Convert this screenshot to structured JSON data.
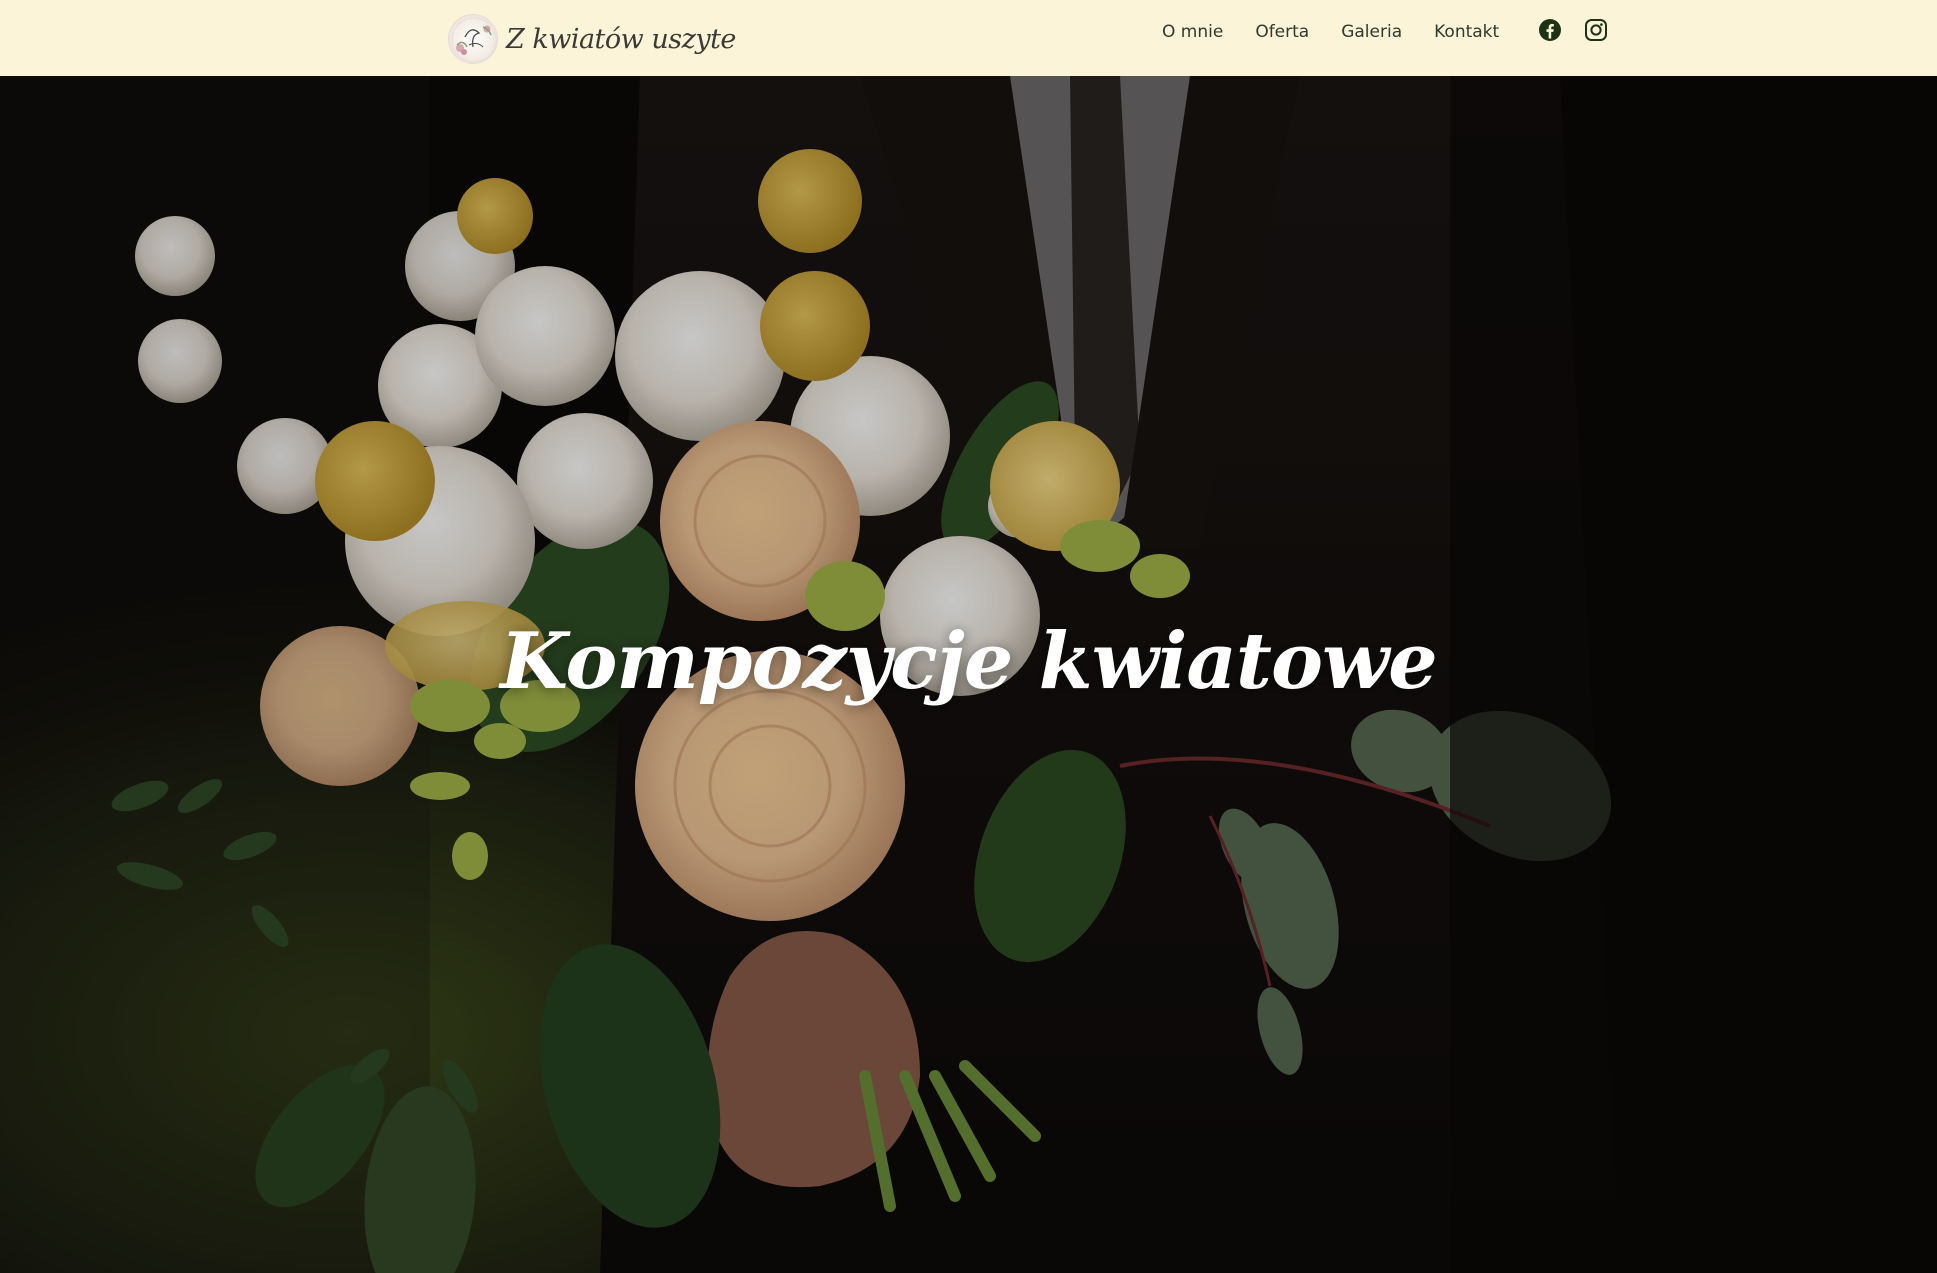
{
  "header": {
    "logo_text": "Z kwiatów uszyte",
    "nav": [
      {
        "label": "O mnie"
      },
      {
        "label": "Oferta"
      },
      {
        "label": "Galeria"
      },
      {
        "label": "Kontakt"
      }
    ],
    "social": [
      {
        "icon": "facebook-icon"
      },
      {
        "icon": "instagram-icon"
      }
    ],
    "colors": {
      "background": "#fcf4d9",
      "text": "#2f3a2e",
      "icon": "#1e3316"
    }
  },
  "hero": {
    "title": "Kompozycje kwiatowe",
    "image": "bridal bouquet of white and peach roses, yellow craspedia and eucalyptus held against a dark suit"
  }
}
